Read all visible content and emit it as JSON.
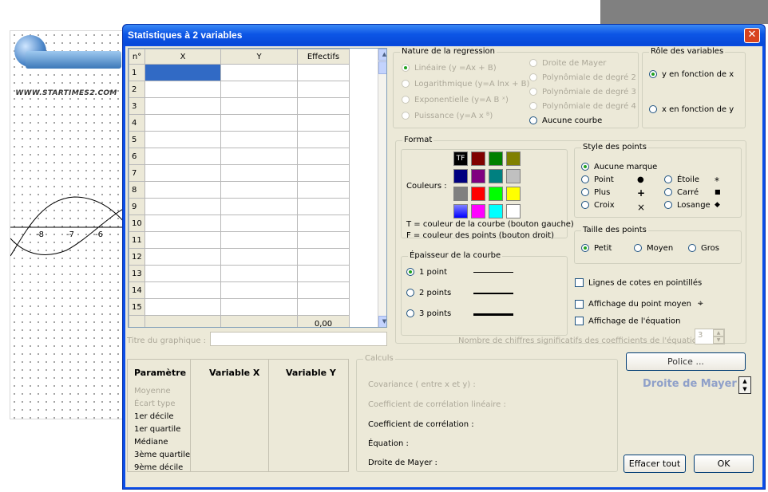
{
  "background": {
    "logo_url_text": "WWW.STARTIMES2.COM",
    "axis_ticks": [
      "-8",
      "-7",
      "-6"
    ]
  },
  "dialog": {
    "title": "Statistiques à 2 variables",
    "close_label": "✕"
  },
  "grid": {
    "headers": [
      "n°",
      "X",
      "Y",
      "Effectifs"
    ],
    "rows": [
      "1",
      "2",
      "3",
      "4",
      "5",
      "6",
      "7",
      "8",
      "9",
      "10",
      "11",
      "12",
      "13",
      "14",
      "15"
    ],
    "total": "0,00"
  },
  "regression": {
    "title": "Nature de la regression",
    "options_left": [
      "Linéaire (y =Ax + B)",
      "Logarithmique (y=A lnx + B)",
      "Exponentielle (y=A B ˣ)",
      "Puissance (y=A x ᴮ)"
    ],
    "options_right": [
      "Droite de Mayer",
      "Polynômiale de degré 2",
      "Polynômiale de degré 3",
      "Polynômiale de degré 4",
      "Aucune courbe"
    ]
  },
  "roles": {
    "title": "Rôle des variables",
    "opt1": "y en fonction de x",
    "opt2": "x en fonction de y"
  },
  "format": {
    "title": "Format",
    "couleurs_label": "Couleurs :",
    "tf_label": "TF",
    "hint_t": "T = couleur de la courbe (bouton gauche)",
    "hint_f": "F = couleur des points (bouton droit)",
    "colors": [
      "#000000",
      "#800000",
      "#008000",
      "#808000",
      "#000080",
      "#800080",
      "#008080",
      "#c0c0c0",
      "#808080",
      "#ff0000",
      "#00ff00",
      "#ffff00",
      "#0000ff",
      "#ff00ff",
      "#00ffff",
      "#ffffff"
    ]
  },
  "epaisseur": {
    "title": "Épaisseur de la courbe",
    "options": [
      "1 point",
      "2 points",
      "3 points"
    ]
  },
  "style_points": {
    "title": "Style des points",
    "aucune": "Aucune marque",
    "point": "Point",
    "plus": "Plus",
    "croix": "Croix",
    "etoile": "Étoile",
    "carre": "Carré",
    "losange": "Losange",
    "sym_point": "●",
    "sym_plus": "+",
    "sym_croix": "×",
    "sym_etoile": "*",
    "sym_carre": "■",
    "sym_losange": "◆"
  },
  "taille": {
    "title": "Taille des points",
    "petit": "Petit",
    "moyen": "Moyen",
    "gros": "Gros"
  },
  "checks": {
    "cotes": "Lignes de cotes en pointillés",
    "point_moyen": "Affichage du point moyen",
    "equation": "Affichage de l'équation"
  },
  "titre_graphique": "Titre du graphique :",
  "chiffres_label": "Nombre de chiffres significatifs des coefficients de l'équation :",
  "chiffres_value": "3",
  "stats": {
    "headers": [
      "Paramètre",
      "Variable X",
      "Variable Y"
    ],
    "params": [
      "Moyenne",
      "Écart type",
      "1er décile",
      "1er quartile",
      "Médiane",
      "3ème quartile",
      "9ème décile"
    ]
  },
  "calculs": {
    "title": "Calculs",
    "lines": [
      "Covariance ( entre x et y) :",
      "Coefficient de corrélation linéaire :",
      "Coefficient de corrélation :",
      "Équation :",
      "Droite de Mayer :"
    ]
  },
  "buttons": {
    "police": "Police ...",
    "mayer": "Droite de Mayer",
    "effacer": "Effacer tout",
    "ok": "OK"
  }
}
